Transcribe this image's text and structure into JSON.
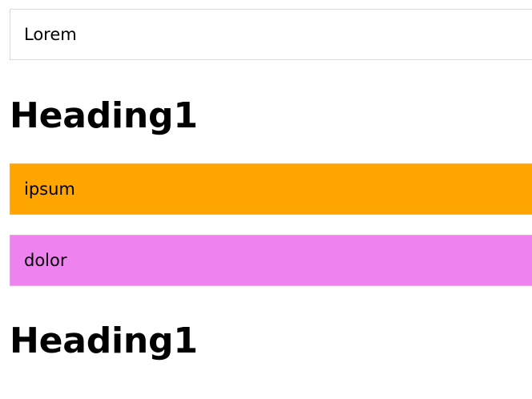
{
  "colors": {
    "ipsum_background": "#ffa500",
    "dolor_background": "#ee82ee"
  },
  "items": [
    {
      "text": "Lorem"
    },
    {
      "heading": "Heading1"
    },
    {
      "text": "ipsum"
    },
    {
      "text": "dolor"
    },
    {
      "heading": "Heading1"
    }
  ]
}
